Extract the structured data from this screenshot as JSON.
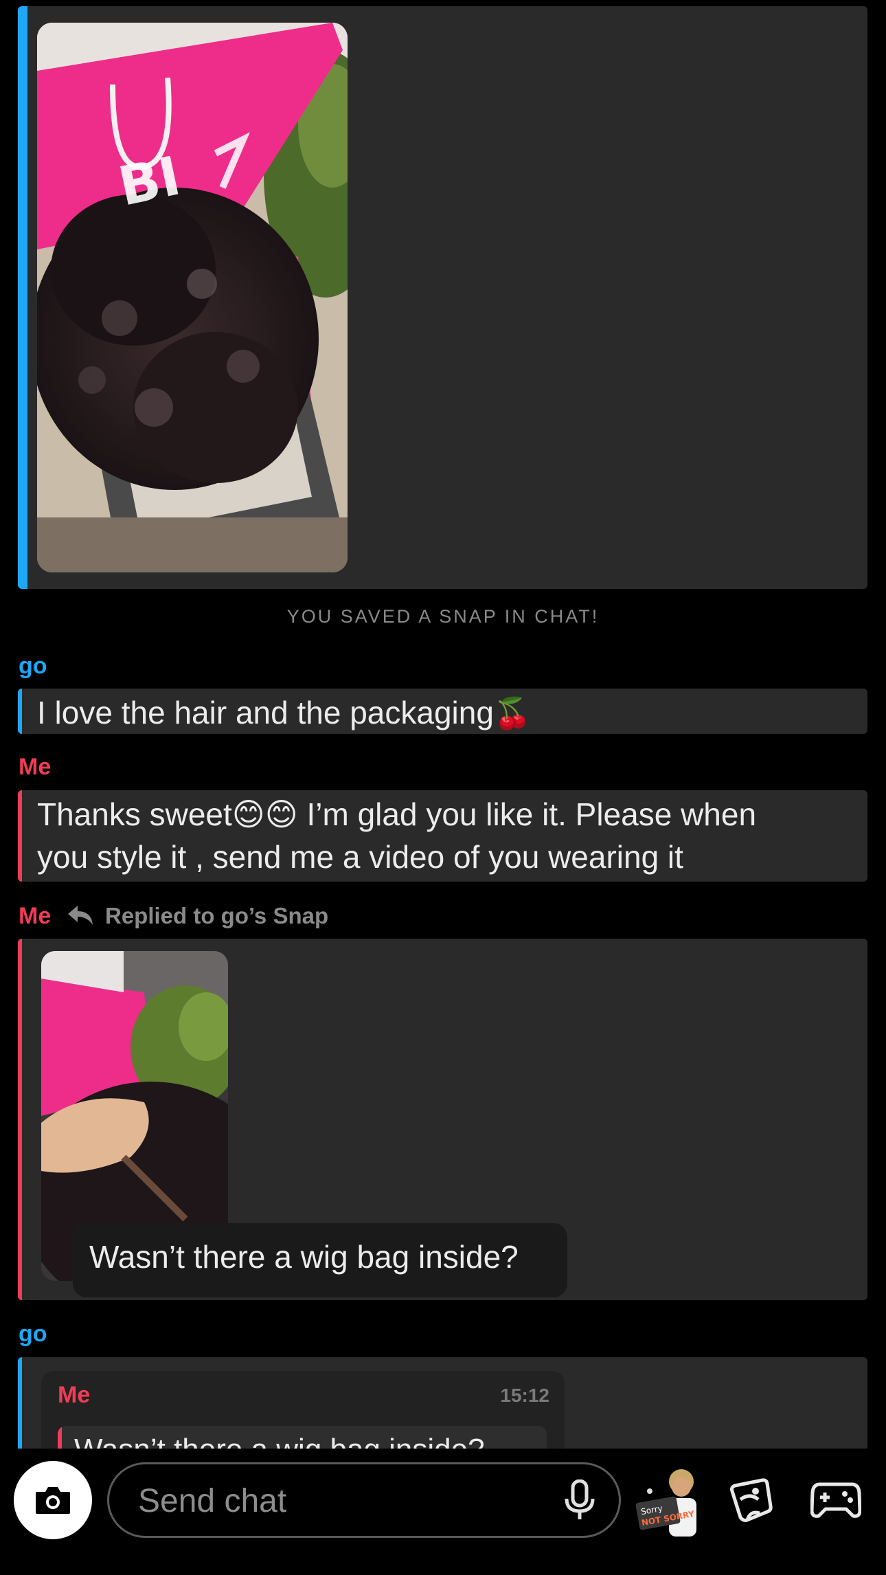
{
  "colors": {
    "background": "#000000",
    "bubble": "#2a2a2a",
    "friend_accent": "#1ea7f5",
    "me_accent": "#f23c57",
    "muted_text": "#8a8a8a"
  },
  "system_notice": "YOU SAVED A SNAP IN CHAT!",
  "messages": [
    {
      "sender": "go",
      "text": "I love the hair and the packaging",
      "emoji": "🍒"
    },
    {
      "sender": "Me",
      "text_line1_pre": "Thanks sweet",
      "text_line1_emoji": "😊😊",
      "text_line1_post": " I’m glad you like it. Please when",
      "text_line2": "you style it , send me a video of you wearing it"
    },
    {
      "sender": "Me",
      "reply_label": "Replied to go’s Snap",
      "caption": "Wasn’t there a wig bag inside?"
    },
    {
      "sender": "go",
      "quote_sender": "Me",
      "quote_time": "15:12",
      "quote_text": "Wasn’t there a wig bag inside?"
    }
  ],
  "footer": {
    "input_placeholder": "Send chat",
    "bitmoji_sticker_text_1": "Sorry",
    "bitmoji_sticker_text_2": "NOT SORRY"
  },
  "icons": [
    "camera-icon",
    "microphone-icon",
    "reply-arrow-icon",
    "bitmoji-icon",
    "sticker-icon",
    "game-controller-icon"
  ]
}
